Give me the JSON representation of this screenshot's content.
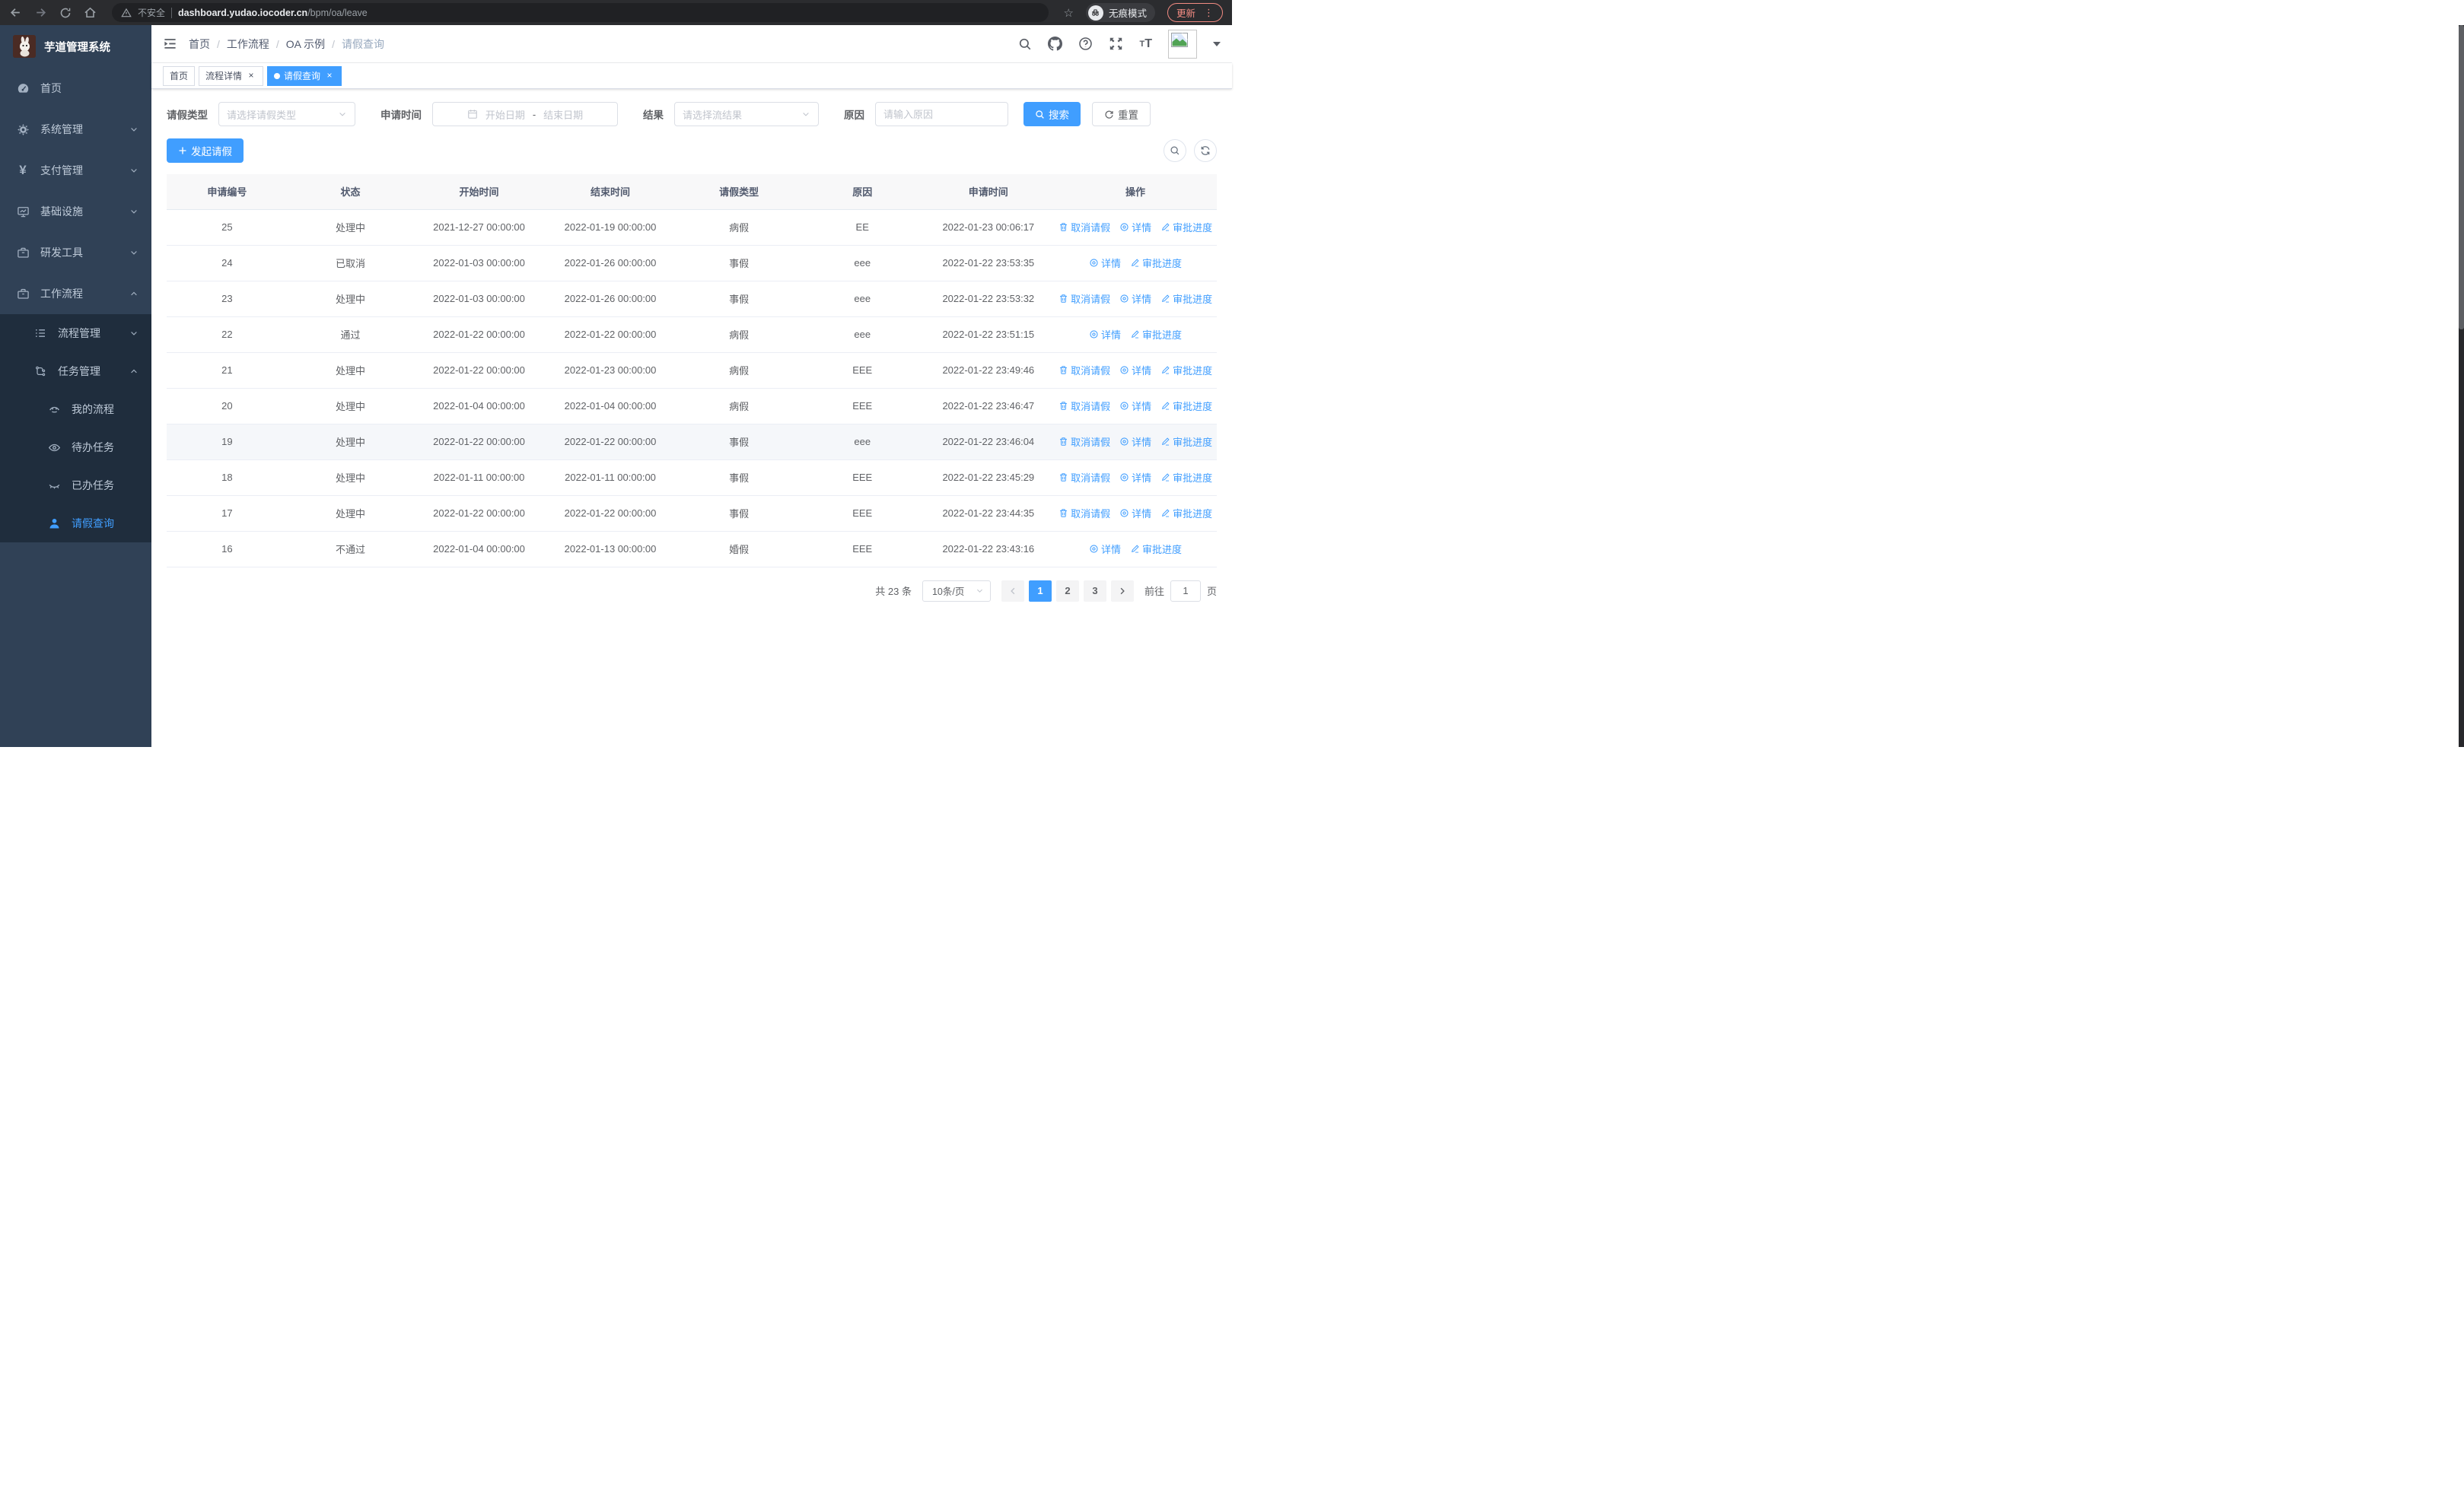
{
  "browser": {
    "security_text": "不安全",
    "url_host": "dashboard.yudao.iocoder.cn",
    "url_path": "/bpm/oa/leave",
    "incognito_label": "无痕模式",
    "update_label": "更新"
  },
  "sidebar": {
    "app_title": "芋道管理系统",
    "items": [
      {
        "label": "首页",
        "icon": "dashboard-icon"
      },
      {
        "label": "系统管理",
        "icon": "gear-icon"
      },
      {
        "label": "支付管理",
        "icon": "yen-icon"
      },
      {
        "label": "基础设施",
        "icon": "monitor-icon"
      },
      {
        "label": "研发工具",
        "icon": "toolbox-icon"
      },
      {
        "label": "工作流程",
        "icon": "briefcase-icon",
        "expanded": true,
        "children": [
          {
            "label": "流程管理",
            "icon": "list-icon"
          },
          {
            "label": "任务管理",
            "icon": "flow-icon",
            "expanded": true,
            "children": [
              {
                "label": "我的流程",
                "icon": "robot-icon"
              },
              {
                "label": "待办任务",
                "icon": "eye-icon"
              },
              {
                "label": "已办任务",
                "icon": "eye-closed-icon"
              },
              {
                "label": "请假查询",
                "icon": "user-icon",
                "active": true
              }
            ]
          }
        ]
      }
    ]
  },
  "navbar": {
    "breadcrumb": [
      "首页",
      "工作流程",
      "OA 示例",
      "请假查询"
    ],
    "separator": "/"
  },
  "tabs": [
    {
      "label": "首页",
      "closable": false,
      "active": false
    },
    {
      "label": "流程详情",
      "closable": true,
      "active": false
    },
    {
      "label": "请假查询",
      "closable": true,
      "active": true
    }
  ],
  "filters": {
    "leave_type_label": "请假类型",
    "leave_type_placeholder": "请选择请假类型",
    "apply_time_label": "申请时间",
    "start_placeholder": "开始日期",
    "range_separator": "-",
    "end_placeholder": "结束日期",
    "result_label": "结果",
    "result_placeholder": "请选择流结果",
    "reason_label": "原因",
    "reason_placeholder": "请输入原因",
    "search_label": "搜索",
    "reset_label": "重置"
  },
  "toolbar": {
    "create_label": "发起请假"
  },
  "table": {
    "columns": [
      "申请编号",
      "状态",
      "开始时间",
      "结束时间",
      "请假类型",
      "原因",
      "申请时间",
      "操作"
    ],
    "column_keys": [
      "id",
      "status",
      "start",
      "end",
      "type",
      "reason",
      "applied"
    ],
    "action_labels": {
      "cancel": "取消请假",
      "detail": "详情",
      "progress": "审批进度"
    },
    "rows": [
      {
        "id": "25",
        "status": "处理中",
        "start": "2021-12-27 00:00:00",
        "end": "2022-01-19 00:00:00",
        "type": "病假",
        "reason": "EE",
        "applied": "2022-01-23 00:06:17",
        "cancelable": true,
        "highlighted": false
      },
      {
        "id": "24",
        "status": "已取消",
        "start": "2022-01-03 00:00:00",
        "end": "2022-01-26 00:00:00",
        "type": "事假",
        "reason": "eee",
        "applied": "2022-01-22 23:53:35",
        "cancelable": false,
        "highlighted": false
      },
      {
        "id": "23",
        "status": "处理中",
        "start": "2022-01-03 00:00:00",
        "end": "2022-01-26 00:00:00",
        "type": "事假",
        "reason": "eee",
        "applied": "2022-01-22 23:53:32",
        "cancelable": true,
        "highlighted": false
      },
      {
        "id": "22",
        "status": "通过",
        "start": "2022-01-22 00:00:00",
        "end": "2022-01-22 00:00:00",
        "type": "病假",
        "reason": "eee",
        "applied": "2022-01-22 23:51:15",
        "cancelable": false,
        "highlighted": false
      },
      {
        "id": "21",
        "status": "处理中",
        "start": "2022-01-22 00:00:00",
        "end": "2022-01-23 00:00:00",
        "type": "病假",
        "reason": "EEE",
        "applied": "2022-01-22 23:49:46",
        "cancelable": true,
        "highlighted": false
      },
      {
        "id": "20",
        "status": "处理中",
        "start": "2022-01-04 00:00:00",
        "end": "2022-01-04 00:00:00",
        "type": "病假",
        "reason": "EEE",
        "applied": "2022-01-22 23:46:47",
        "cancelable": true,
        "highlighted": false
      },
      {
        "id": "19",
        "status": "处理中",
        "start": "2022-01-22 00:00:00",
        "end": "2022-01-22 00:00:00",
        "type": "事假",
        "reason": "eee",
        "applied": "2022-01-22 23:46:04",
        "cancelable": true,
        "highlighted": true
      },
      {
        "id": "18",
        "status": "处理中",
        "start": "2022-01-11 00:00:00",
        "end": "2022-01-11 00:00:00",
        "type": "事假",
        "reason": "EEE",
        "applied": "2022-01-22 23:45:29",
        "cancelable": true,
        "highlighted": false
      },
      {
        "id": "17",
        "status": "处理中",
        "start": "2022-01-22 00:00:00",
        "end": "2022-01-22 00:00:00",
        "type": "事假",
        "reason": "EEE",
        "applied": "2022-01-22 23:44:35",
        "cancelable": true,
        "highlighted": false
      },
      {
        "id": "16",
        "status": "不通过",
        "start": "2022-01-04 00:00:00",
        "end": "2022-01-13 00:00:00",
        "type": "婚假",
        "reason": "EEE",
        "applied": "2022-01-22 23:43:16",
        "cancelable": false,
        "highlighted": false
      }
    ]
  },
  "pagination": {
    "total_label": "共 23 条",
    "page_size_label": "10条/页",
    "pages": [
      "1",
      "2",
      "3"
    ],
    "active_page": "1",
    "goto_label": "前往",
    "goto_value": "1",
    "goto_unit": "页"
  },
  "colors": {
    "accent": "#409eff",
    "sidebar_bg": "#304156",
    "submenu_bg": "#1f2d3d",
    "sidebar_text": "#bfcbd9",
    "update_red": "#f28b82",
    "table_text": "#606266"
  }
}
